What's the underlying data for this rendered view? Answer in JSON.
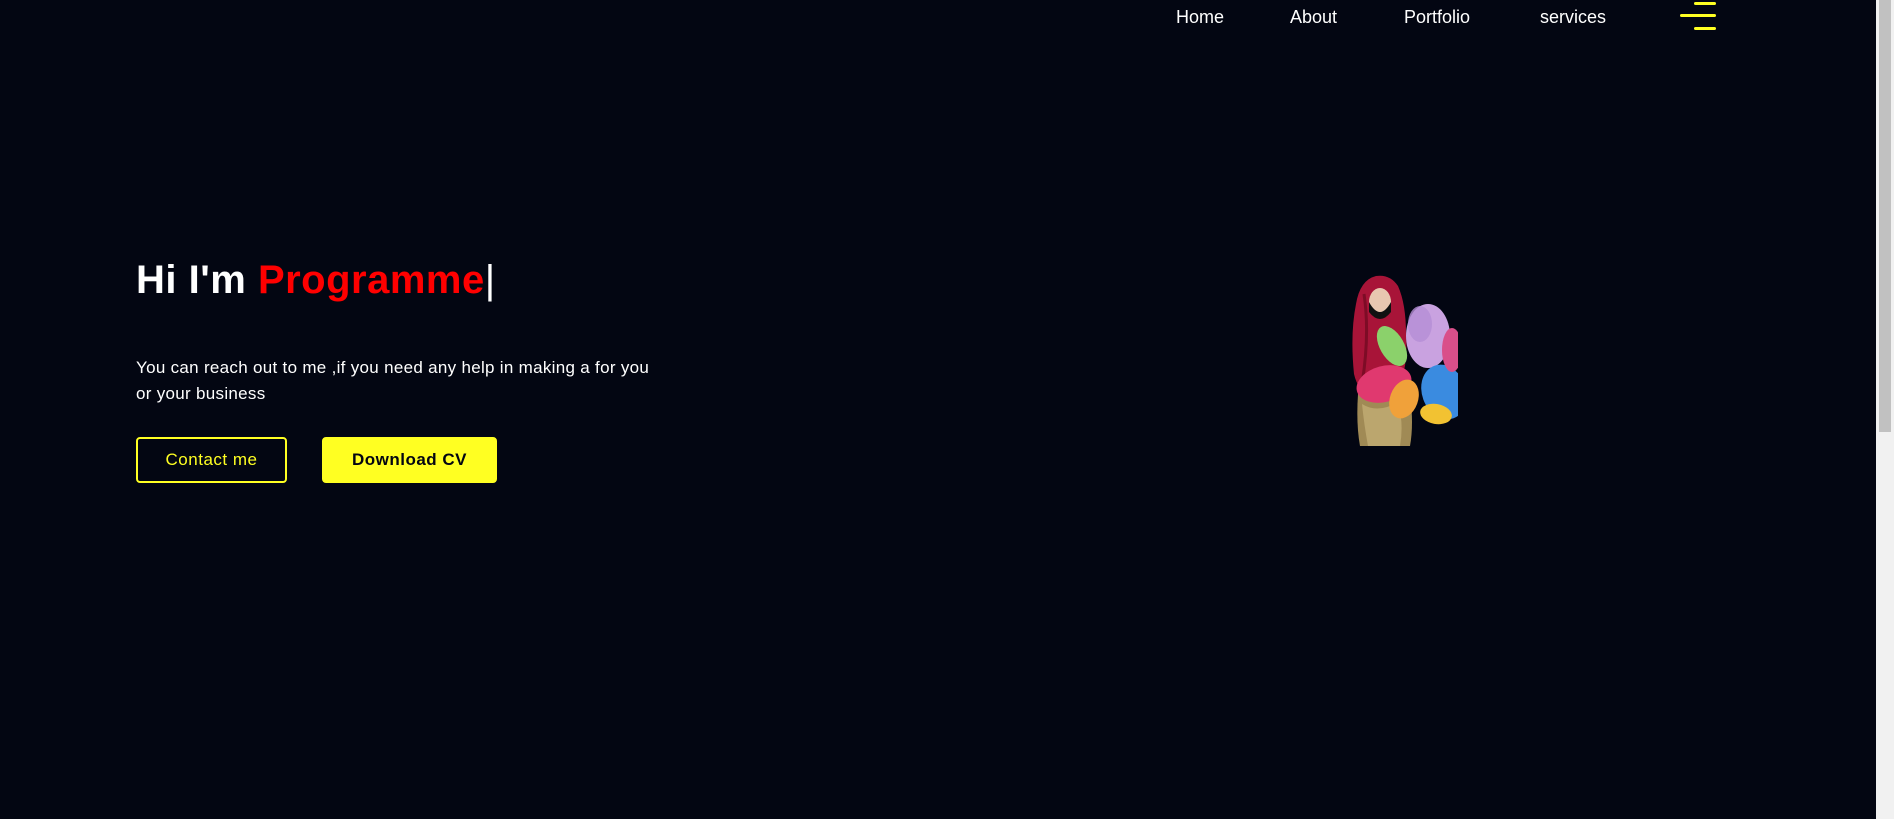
{
  "nav": {
    "links": [
      "Home",
      "About",
      "Portfolio",
      "services"
    ],
    "menu_icon": "hamburger-menu-icon"
  },
  "hero": {
    "greeting": "Hi I'm",
    "role": "Programme",
    "caret": "|",
    "description": "You can reach out to me ,if you need any help in making a for you or your business",
    "buttons": {
      "contact": "Contact me",
      "download": "Download CV"
    }
  },
  "colors": {
    "background": "#030612",
    "accent": "#ffff22",
    "highlight": "#ff0000",
    "text": "#ffffff"
  }
}
